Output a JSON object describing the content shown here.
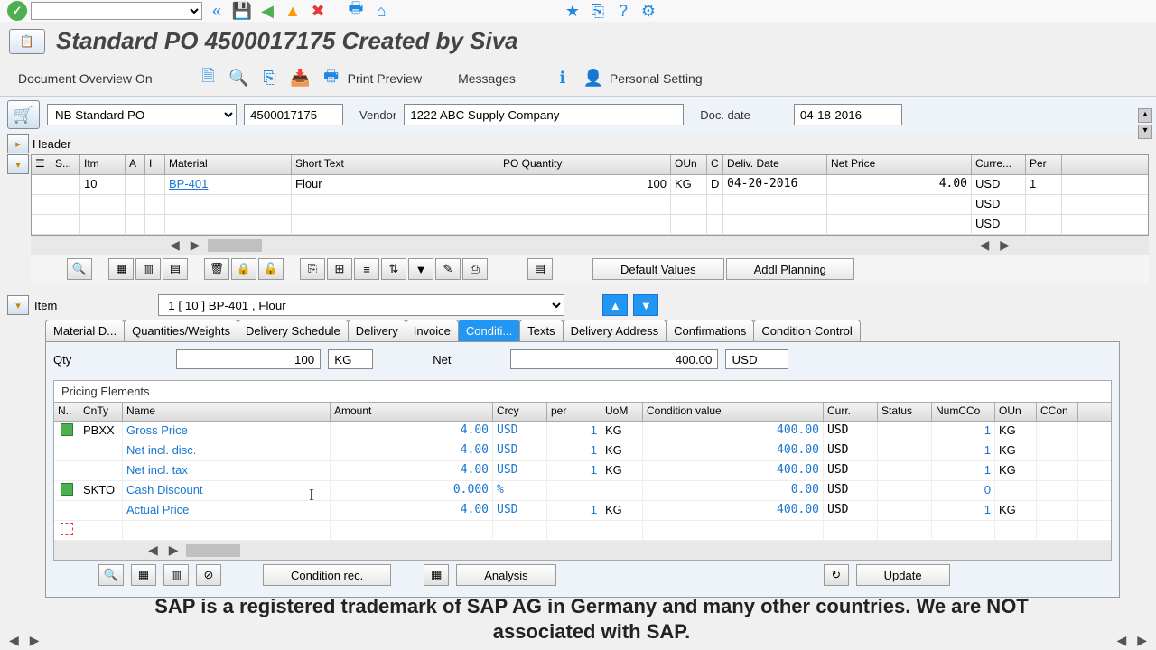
{
  "page_title": "Standard PO 4500017175 Created by Siva",
  "actions": {
    "doc_overview": "Document Overview On",
    "print_preview": "Print Preview",
    "messages": "Messages",
    "personal_setting": "Personal Setting"
  },
  "po": {
    "type": "NB Standard PO",
    "number": "4500017175",
    "vendor_label": "Vendor",
    "vendor": "1222 ABC Supply Company",
    "doc_date_label": "Doc. date",
    "doc_date": "04-18-2016"
  },
  "header_label": "Header",
  "items_columns": {
    "s": "S...",
    "itm": "Itm",
    "a": "A",
    "i": "I",
    "material": "Material",
    "short_text": "Short Text",
    "po_qty": "PO Quantity",
    "oun": "OUn",
    "c": "C",
    "deliv_date": "Deliv. Date",
    "net_price": "Net Price",
    "curr": "Curre...",
    "per": "Per"
  },
  "items": [
    {
      "itm": "10",
      "material": "BP-401",
      "short_text": "Flour",
      "qty": "100",
      "oun": "KG",
      "c": "D",
      "deliv": "04-20-2016",
      "price": "4.00",
      "curr": "USD",
      "per": "1"
    },
    {
      "curr": "USD"
    },
    {
      "curr": "USD"
    }
  ],
  "grid_buttons": {
    "default": "Default Values",
    "addl": "Addl Planning"
  },
  "item_section": {
    "label": "Item",
    "selected": "1 [ 10 ] BP-401 , Flour"
  },
  "tabs": [
    "Material D...",
    "Quantities/Weights",
    "Delivery Schedule",
    "Delivery",
    "Invoice",
    "Conditi...",
    "Texts",
    "Delivery Address",
    "Confirmations",
    "Condition Control"
  ],
  "active_tab": 5,
  "qty": {
    "label": "Qty",
    "value": "100",
    "unit": "KG",
    "net_label": "Net",
    "net_value": "400.00",
    "net_curr": "USD"
  },
  "pricing": {
    "title": "Pricing Elements",
    "columns": {
      "n": "N..",
      "cnty": "CnTy",
      "name": "Name",
      "amount": "Amount",
      "crcy": "Crcy",
      "per": "per",
      "uom": "UoM",
      "cond_val": "Condition value",
      "curr": "Curr.",
      "status": "Status",
      "numcco": "NumCCo",
      "oun": "OUn",
      "ccon": "CCon"
    },
    "rows": [
      {
        "flag": "green",
        "cnty": "PBXX",
        "name": "Gross Price",
        "amount": "4.00",
        "crcy": "USD",
        "per": "1",
        "uom": "KG",
        "cond": "400.00",
        "curr": "USD",
        "num": "1",
        "oun": "KG"
      },
      {
        "name": "Net incl. disc.",
        "amount": "4.00",
        "crcy": "USD",
        "per": "1",
        "uom": "KG",
        "cond": "400.00",
        "curr": "USD",
        "num": "1",
        "oun": "KG"
      },
      {
        "name": "Net incl. tax",
        "amount": "4.00",
        "crcy": "USD",
        "per": "1",
        "uom": "KG",
        "cond": "400.00",
        "curr": "USD",
        "num": "1",
        "oun": "KG"
      },
      {
        "flag": "green",
        "cnty": "SKTO",
        "name": "Cash Discount",
        "amount": "0.000",
        "crcy": "%",
        "cond": "0.00",
        "curr": "USD",
        "num": "0"
      },
      {
        "name": "Actual Price",
        "amount": "4.00",
        "crcy": "USD",
        "per": "1",
        "uom": "KG",
        "cond": "400.00",
        "curr": "USD",
        "num": "1",
        "oun": "KG"
      },
      {
        "flag": "empty"
      }
    ]
  },
  "bottom_buttons": {
    "cond_rec": "Condition rec.",
    "analysis": "Analysis",
    "update": "Update"
  },
  "trademark": "SAP is a registered trademark of SAP AG in Germany and many other countries. We are NOT associated with SAP."
}
